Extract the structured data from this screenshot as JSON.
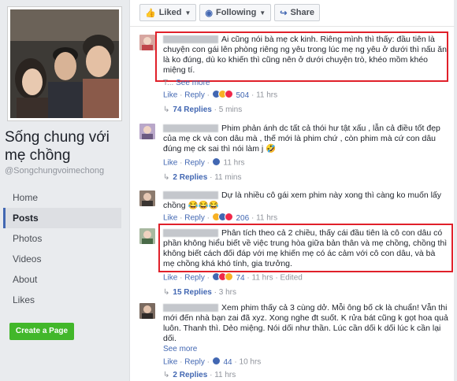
{
  "page": {
    "name": "Sống chung với mẹ chồng",
    "handle": "@Songchungvoimechong",
    "nav": [
      {
        "label": "Home",
        "active": false
      },
      {
        "label": "Posts",
        "active": true
      },
      {
        "label": "Photos",
        "active": false
      },
      {
        "label": "Videos",
        "active": false
      },
      {
        "label": "About",
        "active": false
      },
      {
        "label": "Likes",
        "active": false
      }
    ],
    "create_page_label": "Create a Page"
  },
  "actions": {
    "liked": "Liked",
    "following": "Following",
    "share": "Share"
  },
  "colors": {
    "accent": "#4267b2",
    "highlight": "#e0202a",
    "create": "#42b72a"
  },
  "comments": [
    {
      "text": "Ai cũng nói bà mẹ ck kinh. Riêng mình thì thấy: đầu tiên là chuyện con gái lên phòng riêng ng yêu trong lúc mẹ ng yêu ở dưới thì nấu ăn là ko đúng, dù ko khiến thì cũng nên ở dưới chuyện trò, khéo mồm khéo miệng tí.",
      "see_more": "See more",
      "see_more_prefix": "T...",
      "like": "Like",
      "reply": "Reply",
      "reactions": [
        "like",
        "haha",
        "love"
      ],
      "count": "504",
      "time": "11 hrs",
      "replies": "74 Replies",
      "replies_time": "5 mins"
    },
    {
      "text": "Phim phản ánh dc tất cả thói hư tật xấu , lẫn cả điều tốt đẹp của mẹ ck và con dâu mà , thế mới là phim chứ , còn phim mà cứ con dâu đúng mẹ ck sai thì nói làm j 🤣",
      "like": "Like",
      "reply": "Reply",
      "reactions": [
        "like"
      ],
      "count": "",
      "time": "11 hrs",
      "replies": "2 Replies",
      "replies_time": "11 mins"
    },
    {
      "text": "Dự là nhiều cô gái xem phim này xong thì càng ko muốn lấy chồng 😂😂😂",
      "like": "Like",
      "reply": "Reply",
      "reactions": [
        "haha",
        "like",
        "love"
      ],
      "count": "206",
      "time": "11 hrs"
    },
    {
      "text": "Phân tích theo cả 2 chiều, thấy cái đầu tiên là cô con dâu có phần không hiểu biết về việc trung hòa giữa bản thân và mẹ chồng, chồng thì không biết cách đối đáp với mẹ khiến mẹ có ác cảm với cô con dâu, và bà mẹ chồng khá khó tính, gia trưởng.",
      "like": "Like",
      "reply": "Reply",
      "reactions": [
        "like",
        "love",
        "haha"
      ],
      "count": "74",
      "time": "11 hrs",
      "edited": "Edited",
      "replies": "15 Replies",
      "replies_time": "3 hrs"
    },
    {
      "text": "Xem phim thấy cả 3 cùng dở. Mỗi ông bố ck là chuẩn! Vẫn thi mới đến nhà bạn zai đã xyz. Xong nghe đt suốt. K rửa bát cũng k gọt hoa quả luôn. Thanh thì. Dẻo miệng. Nói dối như thần. Lúc cần dối k dối lúc k cần lại dối.",
      "see_more": "See more",
      "like": "Like",
      "reply": "Reply",
      "reactions": [
        "like"
      ],
      "count": "44",
      "time": "10 hrs",
      "replies": "2 Replies",
      "replies_time": "11 hrs"
    }
  ]
}
